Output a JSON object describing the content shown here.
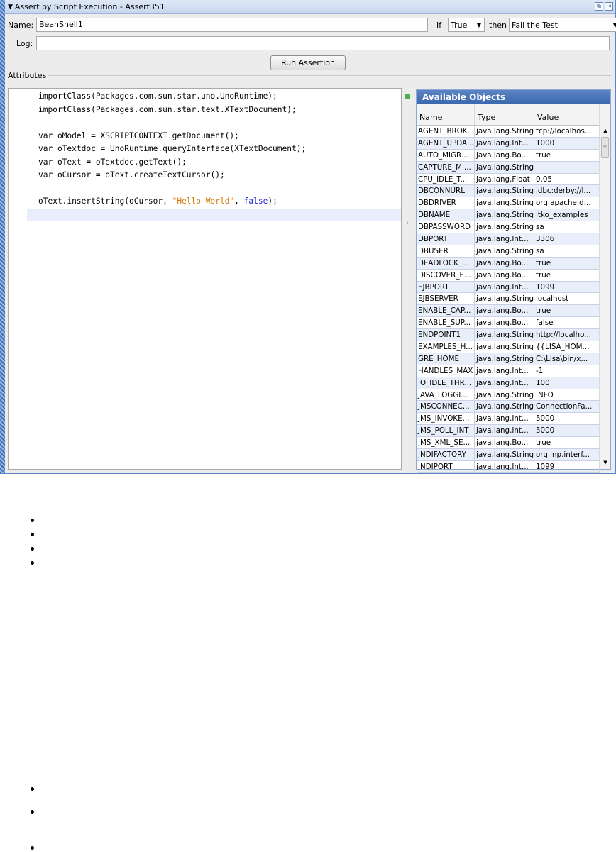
{
  "window": {
    "title": "Assert by Script Execution - Assert351",
    "collapse_icon": "triangle-down-icon",
    "icons": [
      "undock-icon",
      "pin-icon"
    ]
  },
  "form": {
    "name_label": "Name:",
    "name_value": "BeanShell1",
    "if_label": "If",
    "if_value": "True",
    "then_label": "then",
    "then_value": "Fail the Test",
    "log_label": "Log:",
    "log_value": "",
    "run_button": "Run Assertion",
    "attributes_label": "Attributes"
  },
  "code": [
    "importClass(Packages.com.sun.star.uno.UnoRuntime);",
    "importClass(Packages.com.sun.star.text.XTextDocument);",
    "",
    "var oModel = XSCRIPTCONTEXT.getDocument();",
    "var oTextdoc = UnoRuntime.queryInterface(XTextDocument);",
    "var oText = oTextdoc.getText();",
    "var oCursor = oText.createTextCursor();",
    "",
    [
      "oText.insertString(oCursor, ",
      "\"Hello World\"",
      ", ",
      "false",
      ");"
    ],
    ""
  ],
  "objects": {
    "title": "Available Objects",
    "columns": [
      "Name",
      "Type",
      "Value"
    ],
    "rows": [
      [
        "AGENT_BROK...",
        "java.lang.String",
        "tcp://localhos..."
      ],
      [
        "AGENT_UPDA...",
        "java.lang.Int...",
        "1000"
      ],
      [
        "AUTO_MIGR...",
        "java.lang.Bo...",
        "true"
      ],
      [
        "CAPTURE_MI...",
        "java.lang.String",
        ""
      ],
      [
        "CPU_IDLE_T...",
        "java.lang.Float",
        "0.05"
      ],
      [
        "DBCONNURL",
        "java.lang.String",
        "jdbc:derby://l..."
      ],
      [
        "DBDRIVER",
        "java.lang.String",
        "org.apache.d..."
      ],
      [
        "DBNAME",
        "java.lang.String",
        "itko_examples"
      ],
      [
        "DBPASSWORD",
        "java.lang.String",
        "sa"
      ],
      [
        "DBPORT",
        "java.lang.Int...",
        "3306"
      ],
      [
        "DBUSER",
        "java.lang.String",
        "sa"
      ],
      [
        "DEADLOCK_...",
        "java.lang.Bo...",
        "true"
      ],
      [
        "DISCOVER_E...",
        "java.lang.Bo...",
        "true"
      ],
      [
        "EJBPORT",
        "java.lang.Int...",
        "1099"
      ],
      [
        "EJBSERVER",
        "java.lang.String",
        "localhost"
      ],
      [
        "ENABLE_CAP...",
        "java.lang.Bo...",
        "true"
      ],
      [
        "ENABLE_SUP...",
        "java.lang.Bo...",
        "false"
      ],
      [
        "ENDPOINT1",
        "java.lang.String",
        "http://localho..."
      ],
      [
        "EXAMPLES_H...",
        "java.lang.String",
        "{{LISA_HOM..."
      ],
      [
        "GRE_HOME",
        "java.lang.String",
        "C:\\Lisa\\bin/x..."
      ],
      [
        "HANDLES_MAX",
        "java.lang.Int...",
        "-1"
      ],
      [
        "IO_IDLE_THR...",
        "java.lang.Int...",
        "100"
      ],
      [
        "JAVA_LOGGI...",
        "java.lang.String",
        "INFO"
      ],
      [
        "JMSCONNEC...",
        "java.lang.String",
        "ConnectionFa..."
      ],
      [
        "JMS_INVOKE...",
        "java.lang.Int...",
        "5000"
      ],
      [
        "JMS_POLL_INT",
        "java.lang.Int...",
        "5000"
      ],
      [
        "JMS_XML_SE...",
        "java.lang.Bo...",
        "true"
      ],
      [
        "JNDIFACTORY",
        "java.lang.String",
        "org.jnp.interf..."
      ],
      [
        "JNDIPORT",
        "java.lang.Int...",
        "1099"
      ]
    ]
  },
  "colors": {
    "frame": "#5a86c4",
    "objects_header": "#3a67ad",
    "string_literal": "#d7780a",
    "keyword": "#2020e0"
  }
}
